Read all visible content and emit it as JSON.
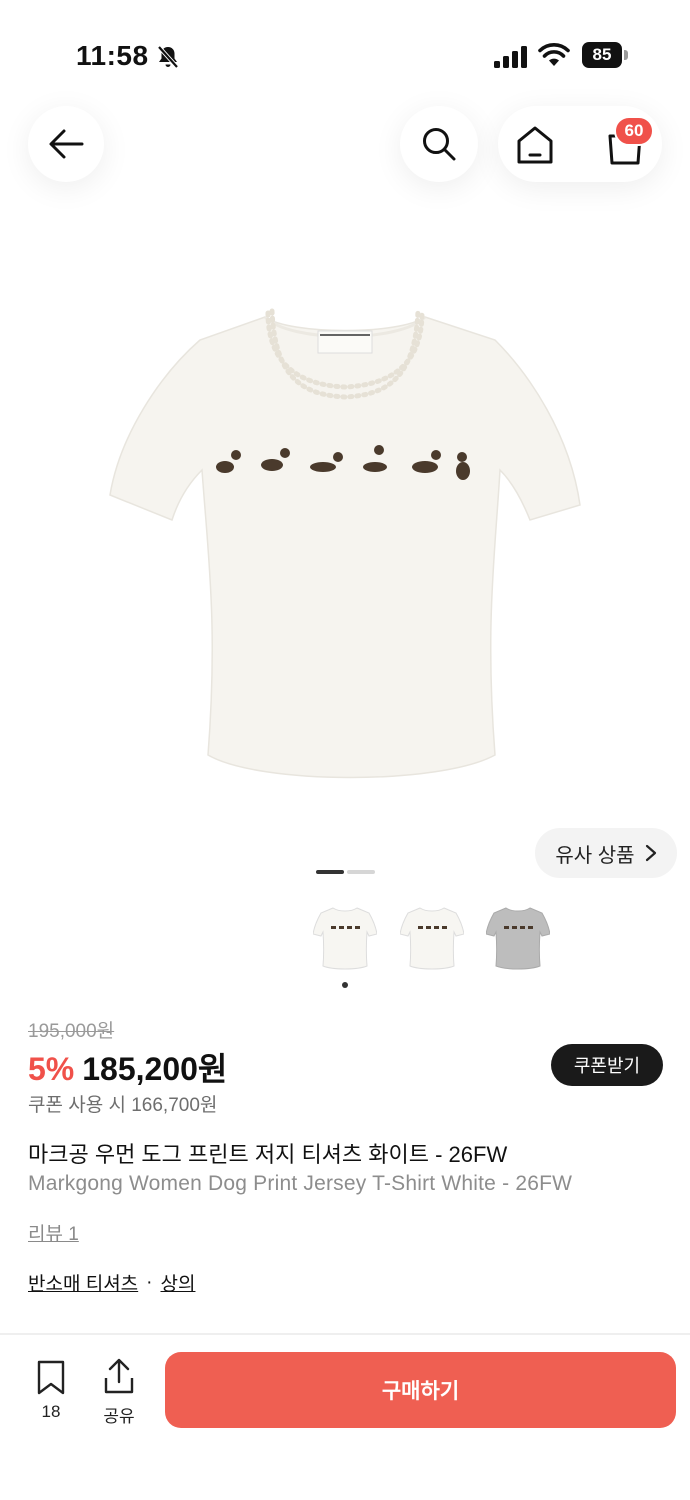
{
  "status_bar": {
    "time": "11:58",
    "battery": "85",
    "icons": [
      "bell-off-icon",
      "signal-icon",
      "wifi-icon",
      "battery-icon"
    ]
  },
  "nav": {
    "back_icon": "arrow-left-icon",
    "search_icon": "search-icon",
    "home_icon": "home-icon",
    "cart_icon": "shopping-bag-icon",
    "cart_badge": "60"
  },
  "gallery": {
    "similar_label": "유사 상품",
    "page_count": 2,
    "active_page": 1,
    "thumbnails": [
      {
        "color": "white",
        "selected": true
      },
      {
        "color": "white",
        "selected": false
      },
      {
        "color": "gray",
        "selected": false
      }
    ]
  },
  "price": {
    "original": "195,000원",
    "discount": "5%",
    "current": "185,200원",
    "coupon_button": "쿠폰받기",
    "coupon_price": "쿠폰 사용 시 166,700원"
  },
  "product": {
    "title_kr": "마크공 우먼 도그 프린트 저지 티셔츠 화이트 - 26FW",
    "title_en": "Markgong Women Dog Print Jersey T-Shirt White - 26FW"
  },
  "links": {
    "review": "리뷰 1",
    "category_1": "반소매 티셔츠",
    "separator": "·",
    "category_2": "상의"
  },
  "bottom_bar": {
    "bookmark_count": "18",
    "share_label": "공유",
    "buy_label": "구매하기"
  },
  "colors": {
    "accent": "#ef5f52",
    "badge": "#f0514a",
    "discount": "#f0514a"
  }
}
